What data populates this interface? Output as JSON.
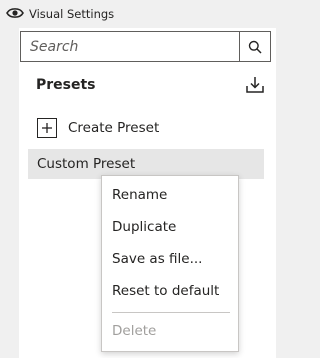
{
  "header": {
    "title": "Visual Settings",
    "icon": "eye-icon"
  },
  "search": {
    "placeholder": "Search",
    "value": "",
    "icon": "search-icon"
  },
  "presets": {
    "heading": "Presets",
    "export_icon": "export-download-icon",
    "create_label": "Create Preset",
    "items": [
      {
        "label": "Custom Preset",
        "selected": true
      }
    ]
  },
  "context_menu": {
    "items": [
      {
        "label": "Rename",
        "enabled": true
      },
      {
        "label": "Duplicate",
        "enabled": true
      },
      {
        "label": "Save as file...",
        "enabled": true
      },
      {
        "label": "Reset to default",
        "enabled": true
      },
      {
        "label": "Delete",
        "enabled": false
      }
    ]
  },
  "colors": {
    "background": "#f0f0f0",
    "panel": "#ffffff",
    "selected_row": "#e6e6e6",
    "text": "#252423",
    "disabled_text": "#a19f9d"
  }
}
